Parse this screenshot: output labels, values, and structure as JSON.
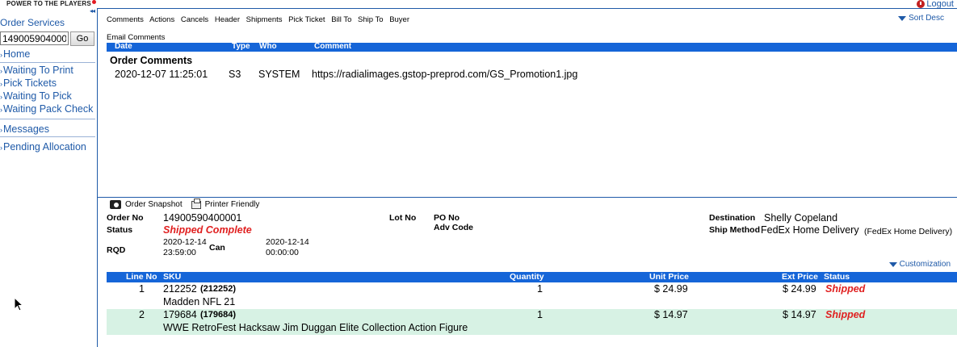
{
  "brand": {
    "tagline": "POWER TO THE PLAYERS"
  },
  "header": {
    "logout_label": "Logout"
  },
  "sidebar": {
    "title": "Order Services",
    "order_input_value": "149005904000",
    "go_label": "Go",
    "items": [
      {
        "label": "Home"
      },
      {
        "label": "Waiting To Print"
      },
      {
        "label": "Pick Tickets"
      },
      {
        "label": "Waiting To Pick"
      },
      {
        "label": "Waiting Pack Check"
      },
      {
        "label": "Messages"
      },
      {
        "label": "Pending Allocation"
      }
    ]
  },
  "tabs": [
    "Comments",
    "Actions",
    "Cancels",
    "Header",
    "Shipments",
    "Pick Ticket",
    "Bill To",
    "Ship To",
    "Buyer"
  ],
  "sort_label": "Sort Desc",
  "email_comments_label": "Email Comments",
  "comments_table": {
    "headers": {
      "date": "Date",
      "type": "Type",
      "who": "Who",
      "comment": "Comment"
    },
    "section_title": "Order Comments",
    "rows": [
      {
        "date": "2020-12-07 11:25:01",
        "type": "S3",
        "who": "SYSTEM",
        "comment": "https://radialimages.gstop-preprod.com/GS_Promotion1.jpg"
      }
    ]
  },
  "tools": {
    "snapshot_label": "Order Snapshot",
    "printer_label": "Printer Friendly"
  },
  "order": {
    "order_no_label": "Order No",
    "order_no": "14900590400001",
    "status_label": "Status",
    "status": "Shipped Complete",
    "rqd_label": "RQD",
    "rqd_date": "2020-12-14",
    "rqd_time": "23:59:00",
    "can_label": "Can",
    "can_date": "2020-12-14",
    "can_time": "00:00:00",
    "lot_no_label": "Lot No",
    "po_no_label": "PO No",
    "adv_code_label": "Adv Code",
    "destination_label": "Destination",
    "destination": "Shelly Copeland",
    "ship_method_label": "Ship Method",
    "ship_method": "FedEx Home Delivery",
    "ship_method_detail": "(FedEx Home Delivery)"
  },
  "customization_label": "Customization",
  "lines_table": {
    "headers": {
      "line_no": "Line No",
      "sku": "SKU",
      "quantity": "Quantity",
      "unit_price": "Unit Price",
      "ext_price": "Ext Price",
      "status": "Status"
    },
    "rows": [
      {
        "line_no": "1",
        "sku": "212252",
        "sku_code": "(212252)",
        "description": "Madden NFL 21",
        "quantity": "1",
        "unit_price": "$ 24.99",
        "ext_price": "$ 24.99",
        "status": "Shipped"
      },
      {
        "line_no": "2",
        "sku": "179684",
        "sku_code": "(179684)",
        "description": "WWE RetroFest Hacksaw Jim Duggan Elite Collection Action Figure",
        "quantity": "1",
        "unit_price": "$ 14.97",
        "ext_price": "$ 14.97",
        "status": "Shipped"
      }
    ]
  }
}
